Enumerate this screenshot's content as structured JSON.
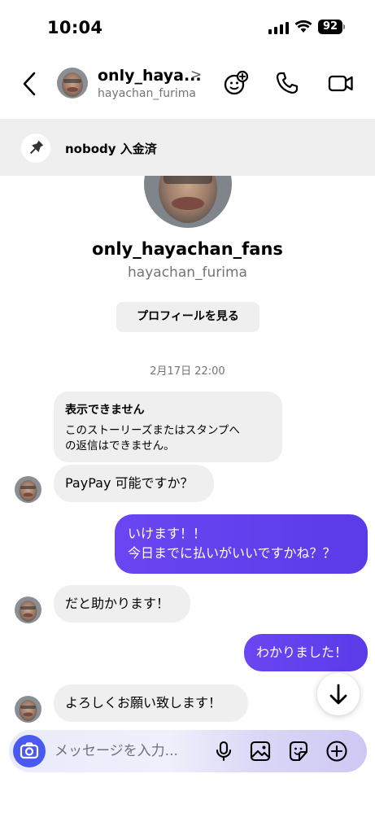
{
  "status_bar": {
    "time": "10:04",
    "battery": "92"
  },
  "header": {
    "display_name": "only_haya...",
    "chevron": ">",
    "username": "hayachan_furima"
  },
  "pinned": {
    "text": "nobody 入金済"
  },
  "profile": {
    "name": "only_hayachan_fans",
    "username": "hayachan_furima",
    "view_profile_label": "プロフィールを見る"
  },
  "timestamp": "2月17日 22:00",
  "unavailable": {
    "title": "表示できません",
    "body_line1": "このストーリーズまたはスタンプへ",
    "body_line2": "の返信はできません。"
  },
  "messages": [
    {
      "direction": "in",
      "text": "PayPay 可能ですか？"
    },
    {
      "direction": "out",
      "line1": "いけます！！",
      "line2": "今日までに払いがいいですかね？？"
    },
    {
      "direction": "in",
      "text": "だと助かります！"
    },
    {
      "direction": "out",
      "text": "わかりました！"
    },
    {
      "direction": "in",
      "text": "よろしくお願い致します！"
    }
  ],
  "composer": {
    "placeholder": "メッセージを入力..."
  },
  "colors": {
    "accent": "#6a46f2",
    "bubble_in": "#efefef",
    "camera_button": "#4a5af0"
  },
  "icons": [
    "back-icon",
    "sticker-add-icon",
    "phone-icon",
    "video-camera-icon",
    "pin-icon",
    "arrow-down-icon",
    "camera-icon",
    "microphone-icon",
    "gallery-icon",
    "sticker-icon",
    "plus-circle-icon"
  ]
}
